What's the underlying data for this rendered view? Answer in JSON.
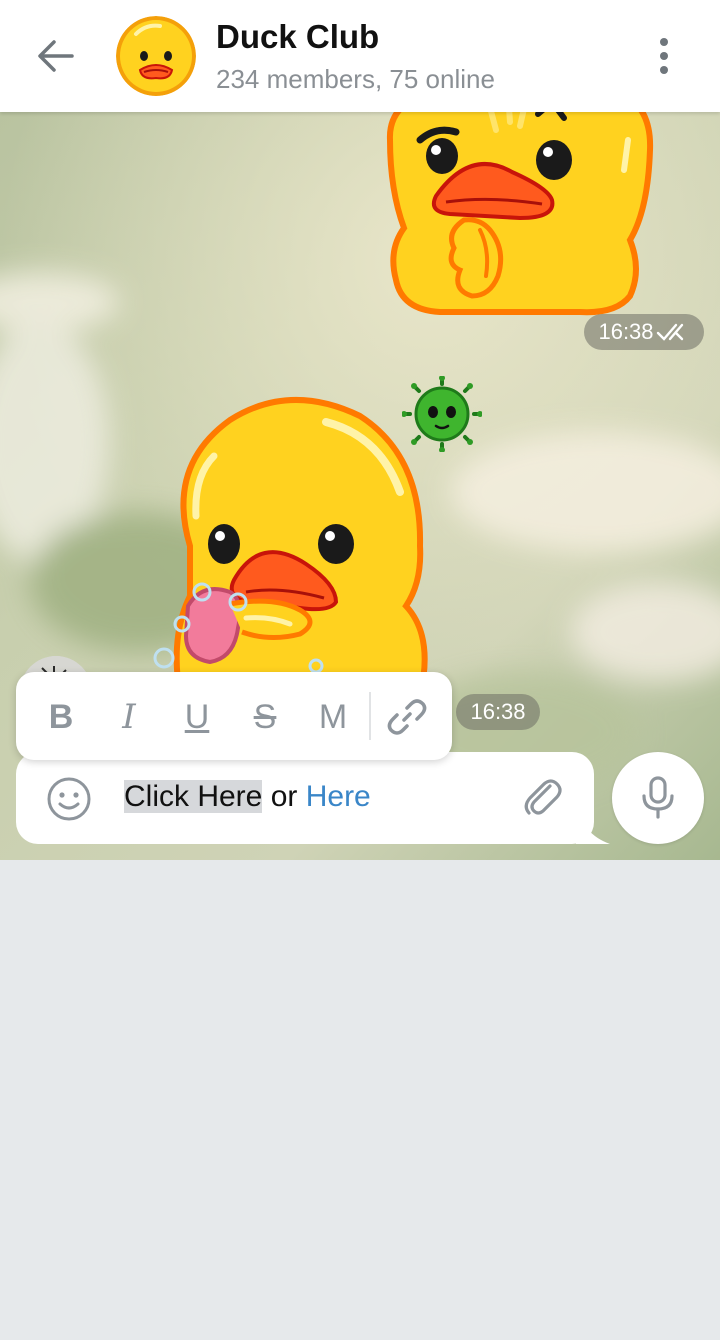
{
  "header": {
    "title": "Duck Club",
    "subtitle": "234 members, 75 online"
  },
  "messages": [
    {
      "time": "16:38",
      "status": "double-check-icon",
      "sticker": "thinking-duck"
    },
    {
      "time": "16:38",
      "sticker": "washing-hands-duck"
    }
  ],
  "format_toolbar": {
    "bold": "B",
    "italic": "I",
    "underline": "U",
    "strike": "S",
    "mono": "M"
  },
  "composer": {
    "text_selected": "Click Here",
    "text_middle": " or ",
    "text_link": "Here"
  },
  "colors": {
    "header_bg": "#ffffff",
    "link": "#3a86c8",
    "icon_gray": "#8e959c",
    "empty_area": "#e6e9eb"
  }
}
